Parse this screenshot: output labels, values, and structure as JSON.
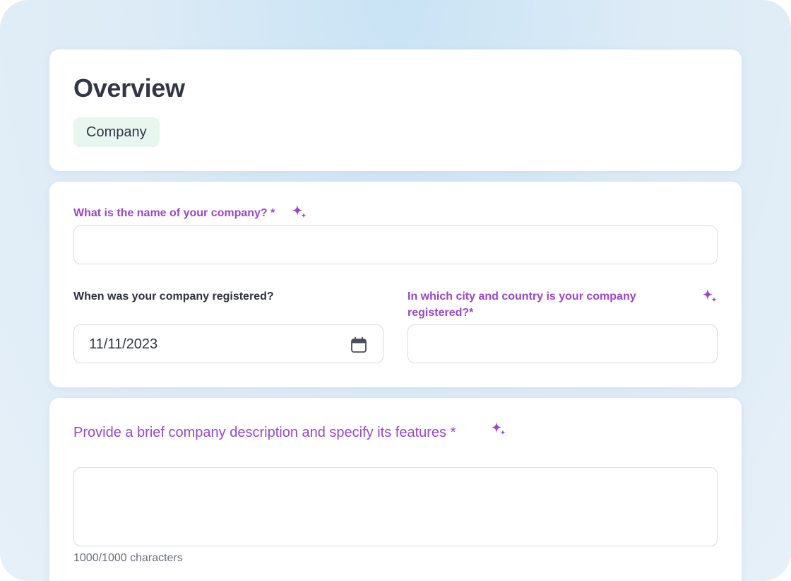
{
  "overview": {
    "title": "Overview",
    "tag": "Company"
  },
  "company_name": {
    "label": "What is the name of your company? *",
    "value": "",
    "icon": "sparkle-icon"
  },
  "registration_date": {
    "label": "When was your company registered?",
    "value": "11/11/2023",
    "icon": "calendar-icon"
  },
  "registration_location": {
    "label": "In which city and country is your company registered?*",
    "value": "",
    "icon": "sparkle-icon"
  },
  "description": {
    "label": "Provide a brief company description and specify its features *",
    "value": "",
    "counter": "1000/1000 characters",
    "icon": "sparkle-icon"
  },
  "colors": {
    "accent": "#9b45c9",
    "tag_bg": "#e7f6ef",
    "text": "#333647"
  }
}
